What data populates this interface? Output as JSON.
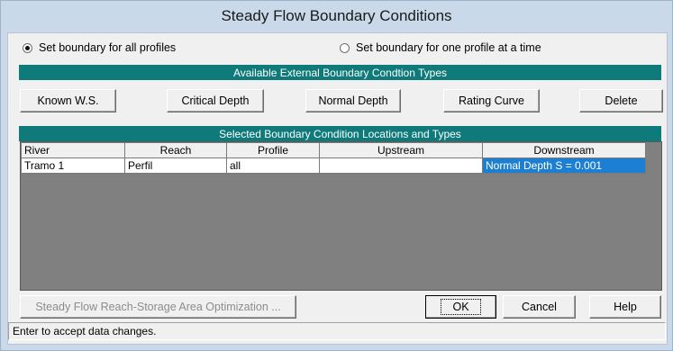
{
  "window": {
    "title": "Steady Flow Boundary Conditions"
  },
  "options": {
    "all_profiles": {
      "label": "Set boundary for all profiles",
      "selected": true
    },
    "one_profile": {
      "label": "Set boundary for one profile at a time",
      "selected": false
    }
  },
  "available_types": {
    "header": "Available External Boundary Condtion Types",
    "buttons": {
      "known_ws": "Known W.S.",
      "critical_depth": "Critical Depth",
      "normal_depth": "Normal Depth",
      "rating_curve": "Rating Curve",
      "delete": "Delete"
    }
  },
  "selected_locations": {
    "header": "Selected Boundary Condition Locations and Types",
    "columns": [
      "River",
      "Reach",
      "Profile",
      "Upstream",
      "Downstream"
    ],
    "rows": [
      {
        "river": "Tramo 1",
        "reach": "Perfil",
        "profile": "all",
        "upstream": "",
        "downstream": "Normal Depth S = 0.001"
      }
    ]
  },
  "footer": {
    "optimization_button": "Steady Flow Reach-Storage Area Optimization ...",
    "ok": "OK",
    "cancel": "Cancel",
    "help": "Help"
  },
  "status": "Enter to accept data changes.",
  "colors": {
    "section_header": "#0f7a7a",
    "selection": "#1d7fd1",
    "grid_background": "#808080"
  }
}
